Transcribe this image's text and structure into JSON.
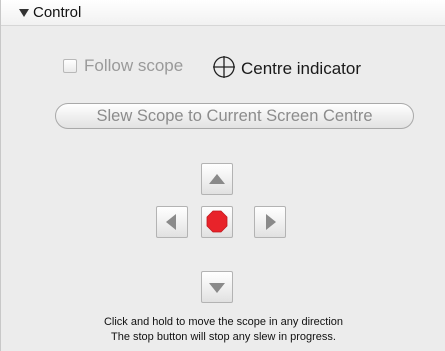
{
  "section": {
    "title": "Control"
  },
  "follow_scope": {
    "label": "Follow scope",
    "checked": false
  },
  "centre_indicator": {
    "label": "Centre indicator",
    "icon": "crosshair-icon"
  },
  "slew_button": {
    "label": "Slew Scope to Current Screen Centre"
  },
  "nav": {
    "up_icon": "arrow-up-icon",
    "down_icon": "arrow-down-icon",
    "left_icon": "arrow-left-icon",
    "right_icon": "arrow-right-icon",
    "stop_icon": "stop-octagon-icon",
    "stop_color": "#e8232a",
    "arrow_color": "#8a8a8a"
  },
  "help": {
    "line1": "Click and hold to move the scope in any direction",
    "line2": "The stop button will stop any slew in progress."
  }
}
